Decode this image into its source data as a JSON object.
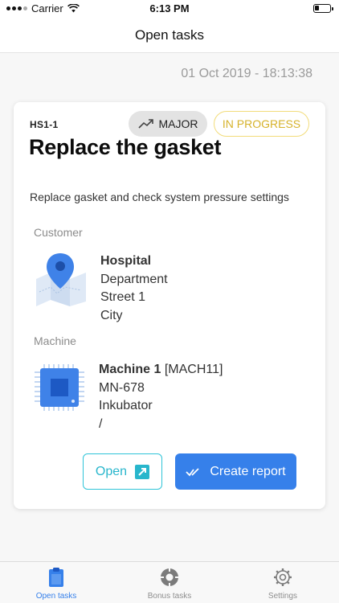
{
  "status_bar": {
    "carrier": "Carrier",
    "time": "6:13 PM"
  },
  "nav": {
    "title": "Open tasks"
  },
  "timestamp": "01 Oct 2019 - 18:13:38",
  "task": {
    "id": "HS1-1",
    "priority": "MAJOR",
    "status": "IN PROGRESS",
    "title": "Replace the gasket",
    "description": "Replace gasket and check system pressure settings",
    "customer": {
      "label": "Customer",
      "name": "Hospital",
      "department": "Department",
      "street": "Street 1",
      "city": "City"
    },
    "machine": {
      "label": "Machine",
      "name": "Machine 1",
      "code": "[MACH11]",
      "serial": "MN-678",
      "type": "Inkubator",
      "extra": "/"
    },
    "actions": {
      "open": "Open",
      "create_report": "Create report"
    }
  },
  "tabs": [
    {
      "label": "Open tasks",
      "icon": "clipboard-icon",
      "active": true
    },
    {
      "label": "Bonus tasks",
      "icon": "lifebuoy-icon",
      "active": false
    },
    {
      "label": "Settings",
      "icon": "gear-icon",
      "active": false
    }
  ],
  "colors": {
    "accent": "#3680ea",
    "open_button": "#28b6cc",
    "status": "#d6b22a",
    "muted": "#9a9a9a"
  }
}
